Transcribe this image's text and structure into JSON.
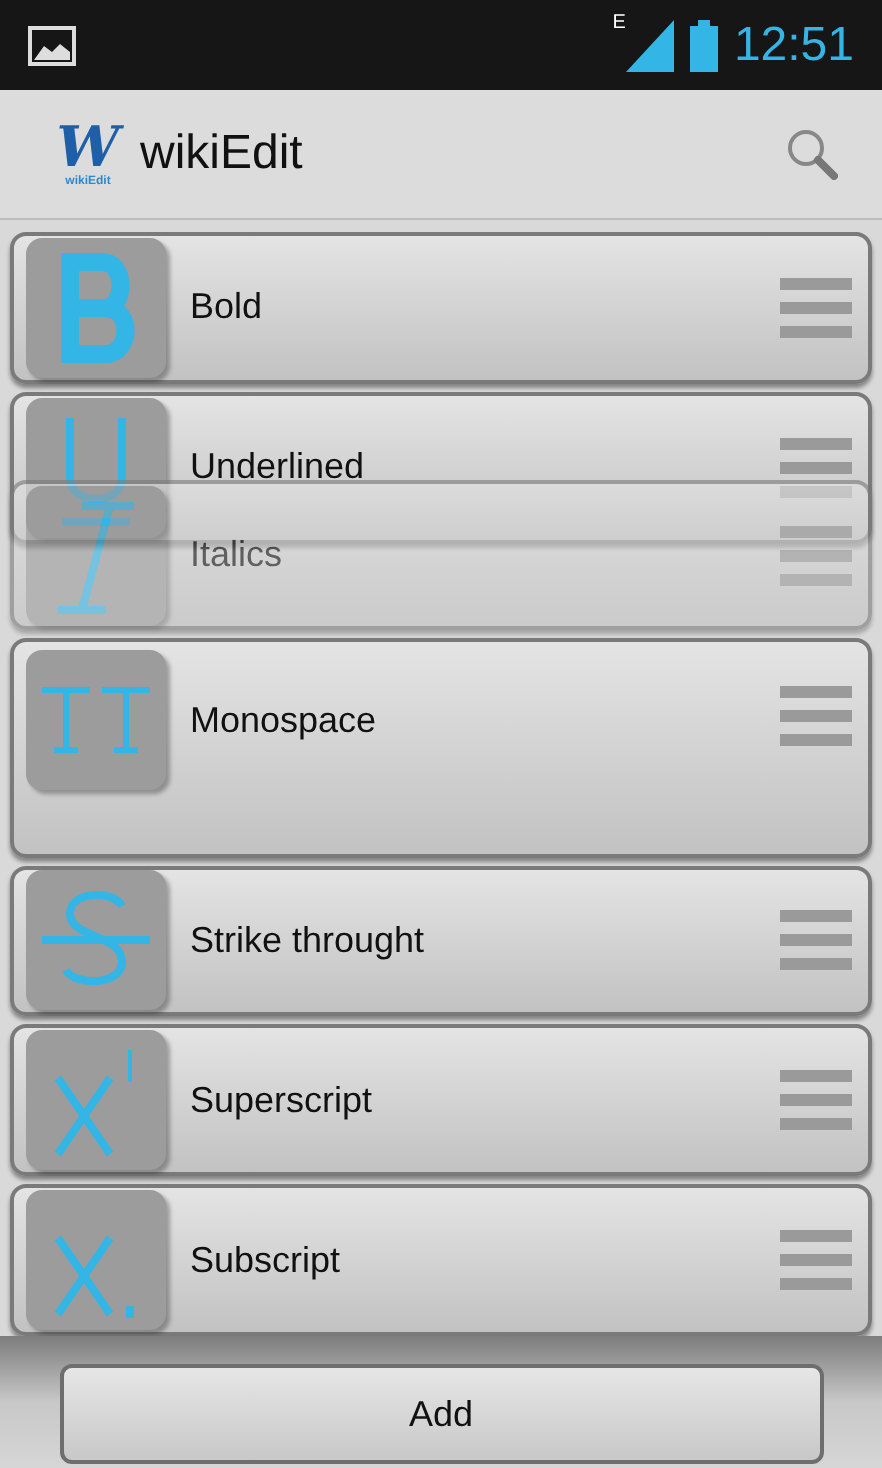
{
  "status_bar": {
    "network_type": "E",
    "time": "12:51"
  },
  "action_bar": {
    "logo_letter": "W",
    "logo_caption": "wikiEdit",
    "title": "wikiEdit"
  },
  "items": [
    {
      "kind": "bold",
      "label": "Bold",
      "dragging": false
    },
    {
      "kind": "underline",
      "label": "Underlined",
      "dragging": false
    },
    {
      "kind": "italic",
      "label": "Italics",
      "dragging": true
    },
    {
      "kind": "mono",
      "label": "Monospace",
      "dragging": false
    },
    {
      "kind": "strike",
      "label": "Strike throught",
      "dragging": false
    },
    {
      "kind": "super",
      "label": "Superscript",
      "dragging": false
    },
    {
      "kind": "sub",
      "label": "Subscript",
      "dragging": false
    }
  ],
  "add_button": "Add"
}
